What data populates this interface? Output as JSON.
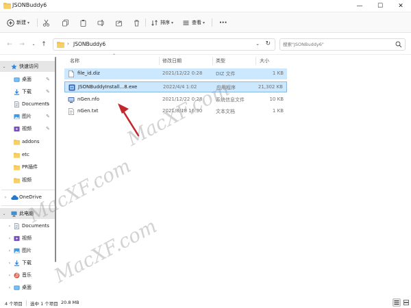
{
  "window": {
    "title": "JSONBuddy6",
    "controls": {
      "minimize": "—",
      "maximize": "☐",
      "close": "✕"
    }
  },
  "toolbar": {
    "new_label": "新建",
    "sort_label": "排序",
    "view_label": "查看",
    "more_label": "···",
    "icons": [
      "plus-icon",
      "cut-icon",
      "copy-icon",
      "rename-icon",
      "share-icon",
      "delete-icon"
    ]
  },
  "address": {
    "path": "JSONBuddy6",
    "search_placeholder": "搜索\"JSONBuddy6\""
  },
  "sidebar": {
    "quick_access": "快速访问",
    "items": [
      {
        "label": "桌面",
        "icon": "desktop-icon",
        "pinned": true
      },
      {
        "label": "下载",
        "icon": "download-icon",
        "pinned": true
      },
      {
        "label": "Documents",
        "icon": "documents-icon",
        "pinned": true
      },
      {
        "label": "图片",
        "icon": "pictures-icon",
        "pinned": true
      },
      {
        "label": "视频",
        "icon": "videos-icon",
        "pinned": true
      },
      {
        "label": "addons",
        "icon": "folder-icon",
        "pinned": false
      },
      {
        "label": "etc",
        "icon": "folder-icon",
        "pinned": false
      },
      {
        "label": "PR插件",
        "icon": "folder-icon",
        "pinned": false
      },
      {
        "label": "视频",
        "icon": "folder-icon",
        "pinned": false
      }
    ],
    "onedrive": "OneDrive",
    "this_pc": "此电脑",
    "pc_items": [
      {
        "label": "Documents",
        "icon": "documents-icon"
      },
      {
        "label": "视频",
        "icon": "videos-icon"
      },
      {
        "label": "图片",
        "icon": "pictures-icon"
      },
      {
        "label": "下载",
        "icon": "download-icon"
      },
      {
        "label": "音乐",
        "icon": "music-icon"
      },
      {
        "label": "桌面",
        "icon": "desktop-icon"
      }
    ]
  },
  "columns": {
    "name": "名称",
    "date": "修改日期",
    "type": "类型",
    "size": "大小"
  },
  "files": [
    {
      "name": "file_id.diz",
      "date": "2021/12/22 0:28",
      "type": "DIZ 文件",
      "size": "1 KB",
      "icon": "document-icon",
      "selected": true,
      "focused": false
    },
    {
      "name": "JSONBuddyInstall...8.exe",
      "date": "2022/4/4 1:02",
      "type": "应用程序",
      "size": "21,302 KB",
      "icon": "installer-icon",
      "selected": true,
      "focused": true
    },
    {
      "name": "nGen.nfo",
      "date": "2021/12/22 0:28",
      "type": "系统信息文件",
      "size": "10 KB",
      "icon": "system-info-icon",
      "selected": false,
      "focused": false
    },
    {
      "name": "nGen.txt",
      "date": "2021/8/18 16:30",
      "type": "文本文档",
      "size": "1 KB",
      "icon": "text-file-icon",
      "selected": false,
      "focused": false
    }
  ],
  "watermarks": [
    "MacXF.com",
    "MacXF.com",
    "MacXF.com"
  ],
  "status": {
    "count": "4 个项目",
    "selected": "选中 1 个项目",
    "size": "20.8 MB"
  },
  "colors": {
    "selection": "#cce8ff",
    "arrow": "#c0282d",
    "folder": "#f2c14e"
  }
}
